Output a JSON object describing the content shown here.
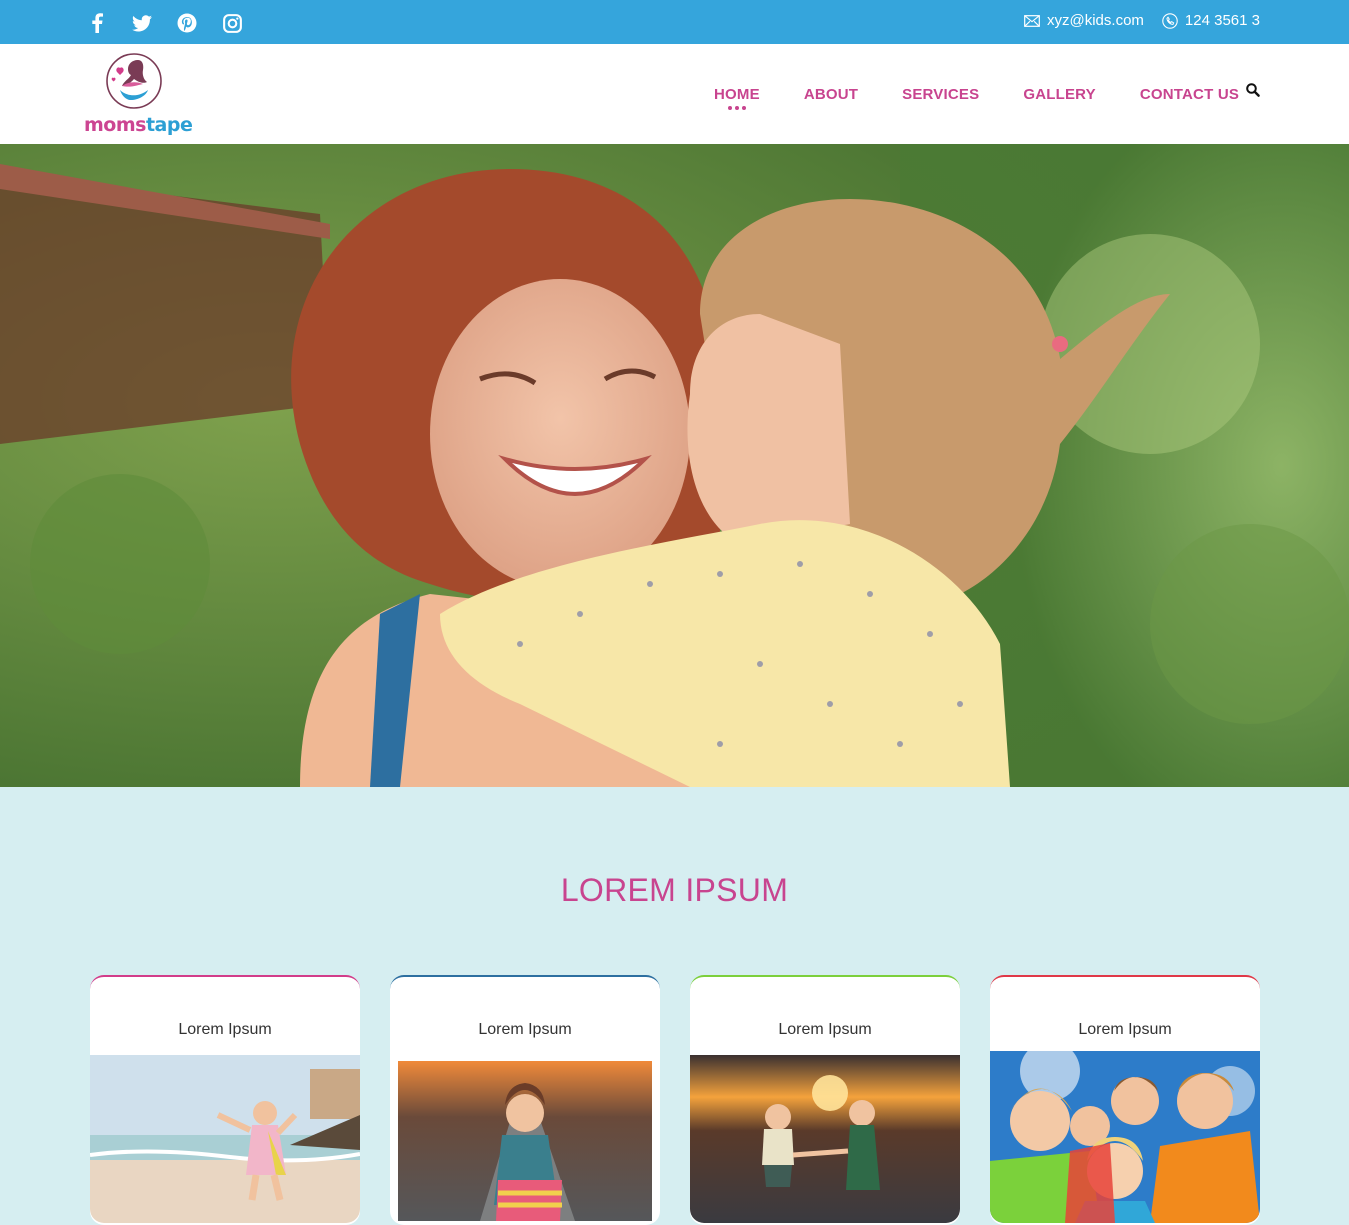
{
  "topbar": {
    "social_icons": [
      "facebook-icon",
      "twitter-icon",
      "pinterest-icon",
      "instagram-icon"
    ],
    "email": "xyz@kids.com",
    "phone": "124 3561 3"
  },
  "logo": {
    "text_part1": "moms",
    "text_part2": "tape"
  },
  "nav": {
    "items": [
      {
        "label": "HOME",
        "active": true
      },
      {
        "label": "ABOUT"
      },
      {
        "label": "SERVICES"
      },
      {
        "label": "GALLERY"
      },
      {
        "label": "CONTACT US"
      }
    ]
  },
  "section": {
    "title": "LOREM IPSUM"
  },
  "cards": [
    {
      "title": "Lorem Ipsum",
      "accent": "#d23c8a"
    },
    {
      "title": "Lorem Ipsum",
      "accent": "#2d6fa0"
    },
    {
      "title": "Lorem Ipsum",
      "accent": "#7ccf3c"
    },
    {
      "title": "Lorem Ipsum",
      "accent": "#e03848"
    }
  ],
  "colors": {
    "topbar": "#35a5dc",
    "brand_pink": "#c8448f",
    "brand_blue": "#2c9fd4",
    "section_bg": "#d6eef1"
  }
}
